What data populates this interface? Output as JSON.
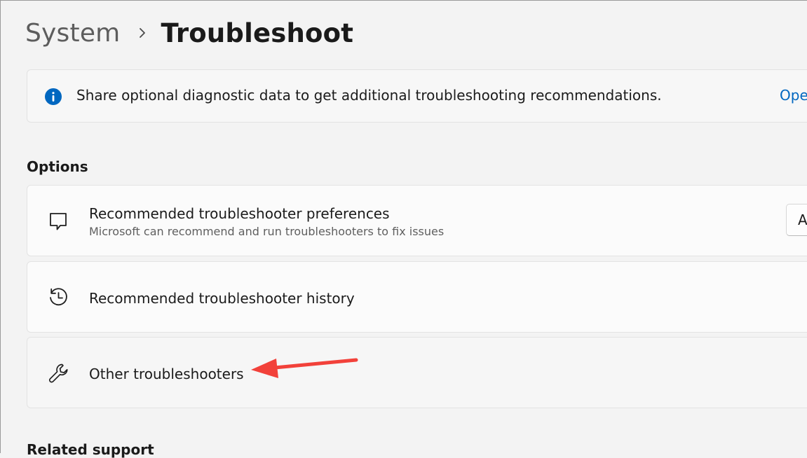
{
  "breadcrumb": {
    "parent": "System",
    "separator_icon": "chevron-right-icon",
    "current": "Troubleshoot"
  },
  "banner": {
    "icon": "info-icon",
    "text": "Share optional diagnostic data to get additional troubleshooting recommendations.",
    "link_text": "Ope",
    "accent_color": "#0067c0"
  },
  "options": {
    "heading": "Options",
    "items": [
      {
        "icon": "chat-bubble-icon",
        "title": "Recommended troubleshooter preferences",
        "subtitle": "Microsoft can recommend and run troubleshooters to fix issues",
        "dropdown_value": "A"
      },
      {
        "icon": "history-icon",
        "title": "Recommended troubleshooter history"
      },
      {
        "icon": "wrench-icon",
        "title": "Other troubleshooters"
      }
    ]
  },
  "related": {
    "heading": "Related support"
  },
  "annotation": {
    "arrow_color": "#f2413a"
  }
}
